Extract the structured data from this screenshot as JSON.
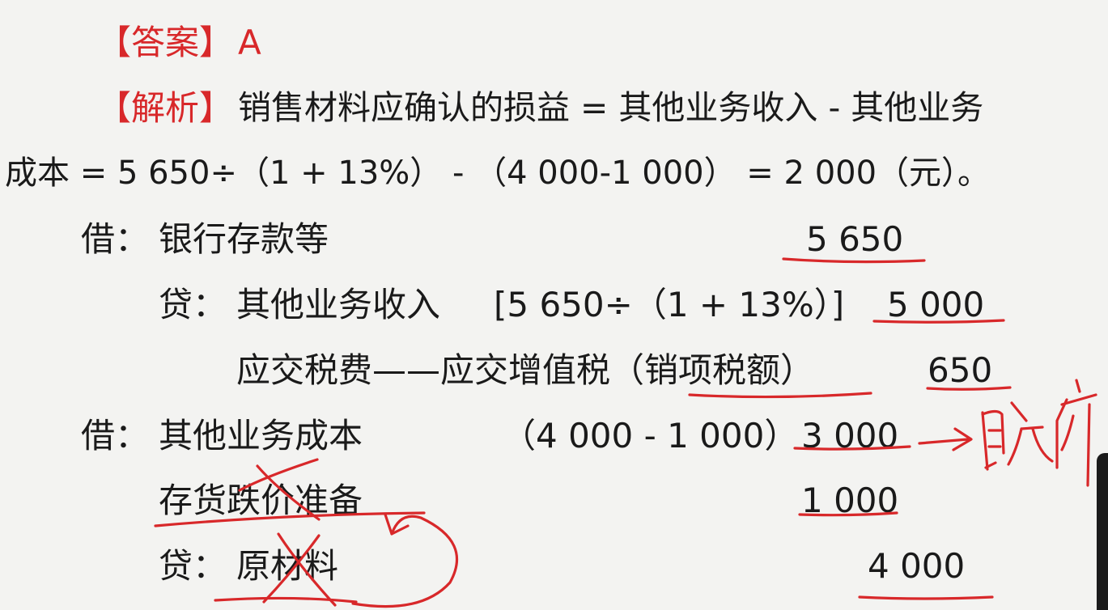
{
  "answer": {
    "bracket_label": "【答案】",
    "value": "A"
  },
  "analysis": {
    "bracket_label": "【解析】",
    "line1": "销售材料应确认的损益 = 其他业务收入 - 其他业务",
    "line2": "成本 = 5 650÷（1 + 13%） - （4 000-1 000） = 2 000（元）。"
  },
  "entries": [
    {
      "prefix": "借：",
      "account": "银行存款等",
      "amount": "5 650"
    },
    {
      "prefix": "贷：",
      "account": "其他业务收入",
      "calc": "[5 650÷（1 + 13%）]",
      "amount": "5 000"
    },
    {
      "account": "应交税费——应交增值税（销项税额）",
      "amount": "650"
    },
    {
      "prefix": "借：",
      "account": "其他业务成本",
      "calc": "（4 000 - 1 000）",
      "amount": "3 000"
    },
    {
      "account": "存货跌价准备",
      "amount": "1 000"
    },
    {
      "prefix": "贷：",
      "account": "原材料",
      "amount": "4 000"
    }
  ],
  "handwritten_note": "账价",
  "colors": {
    "accent": "#d8282a",
    "text": "#1a1a1a",
    "background": "#f3f3f1"
  }
}
